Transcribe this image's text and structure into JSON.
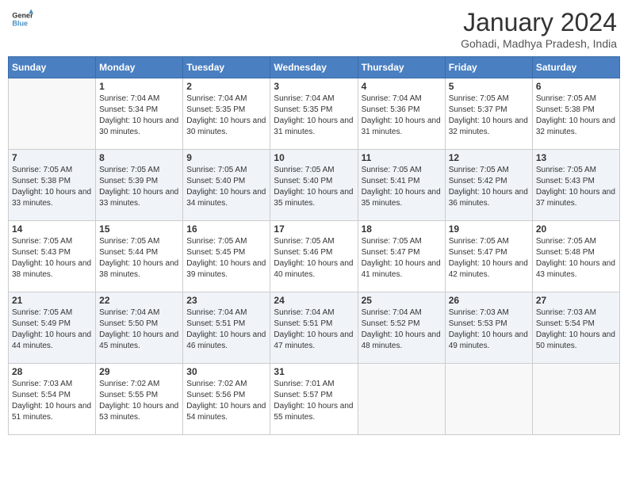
{
  "header": {
    "logo_general": "General",
    "logo_blue": "Blue",
    "month": "January 2024",
    "location": "Gohadi, Madhya Pradesh, India"
  },
  "days_of_week": [
    "Sunday",
    "Monday",
    "Tuesday",
    "Wednesday",
    "Thursday",
    "Friday",
    "Saturday"
  ],
  "weeks": [
    [
      {
        "day": "",
        "sunrise": "",
        "sunset": "",
        "daylight": ""
      },
      {
        "day": "1",
        "sunrise": "Sunrise: 7:04 AM",
        "sunset": "Sunset: 5:34 PM",
        "daylight": "Daylight: 10 hours and 30 minutes."
      },
      {
        "day": "2",
        "sunrise": "Sunrise: 7:04 AM",
        "sunset": "Sunset: 5:35 PM",
        "daylight": "Daylight: 10 hours and 30 minutes."
      },
      {
        "day": "3",
        "sunrise": "Sunrise: 7:04 AM",
        "sunset": "Sunset: 5:35 PM",
        "daylight": "Daylight: 10 hours and 31 minutes."
      },
      {
        "day": "4",
        "sunrise": "Sunrise: 7:04 AM",
        "sunset": "Sunset: 5:36 PM",
        "daylight": "Daylight: 10 hours and 31 minutes."
      },
      {
        "day": "5",
        "sunrise": "Sunrise: 7:05 AM",
        "sunset": "Sunset: 5:37 PM",
        "daylight": "Daylight: 10 hours and 32 minutes."
      },
      {
        "day": "6",
        "sunrise": "Sunrise: 7:05 AM",
        "sunset": "Sunset: 5:38 PM",
        "daylight": "Daylight: 10 hours and 32 minutes."
      }
    ],
    [
      {
        "day": "7",
        "sunrise": "Sunrise: 7:05 AM",
        "sunset": "Sunset: 5:38 PM",
        "daylight": "Daylight: 10 hours and 33 minutes."
      },
      {
        "day": "8",
        "sunrise": "Sunrise: 7:05 AM",
        "sunset": "Sunset: 5:39 PM",
        "daylight": "Daylight: 10 hours and 33 minutes."
      },
      {
        "day": "9",
        "sunrise": "Sunrise: 7:05 AM",
        "sunset": "Sunset: 5:40 PM",
        "daylight": "Daylight: 10 hours and 34 minutes."
      },
      {
        "day": "10",
        "sunrise": "Sunrise: 7:05 AM",
        "sunset": "Sunset: 5:40 PM",
        "daylight": "Daylight: 10 hours and 35 minutes."
      },
      {
        "day": "11",
        "sunrise": "Sunrise: 7:05 AM",
        "sunset": "Sunset: 5:41 PM",
        "daylight": "Daylight: 10 hours and 35 minutes."
      },
      {
        "day": "12",
        "sunrise": "Sunrise: 7:05 AM",
        "sunset": "Sunset: 5:42 PM",
        "daylight": "Daylight: 10 hours and 36 minutes."
      },
      {
        "day": "13",
        "sunrise": "Sunrise: 7:05 AM",
        "sunset": "Sunset: 5:43 PM",
        "daylight": "Daylight: 10 hours and 37 minutes."
      }
    ],
    [
      {
        "day": "14",
        "sunrise": "Sunrise: 7:05 AM",
        "sunset": "Sunset: 5:43 PM",
        "daylight": "Daylight: 10 hours and 38 minutes."
      },
      {
        "day": "15",
        "sunrise": "Sunrise: 7:05 AM",
        "sunset": "Sunset: 5:44 PM",
        "daylight": "Daylight: 10 hours and 38 minutes."
      },
      {
        "day": "16",
        "sunrise": "Sunrise: 7:05 AM",
        "sunset": "Sunset: 5:45 PM",
        "daylight": "Daylight: 10 hours and 39 minutes."
      },
      {
        "day": "17",
        "sunrise": "Sunrise: 7:05 AM",
        "sunset": "Sunset: 5:46 PM",
        "daylight": "Daylight: 10 hours and 40 minutes."
      },
      {
        "day": "18",
        "sunrise": "Sunrise: 7:05 AM",
        "sunset": "Sunset: 5:47 PM",
        "daylight": "Daylight: 10 hours and 41 minutes."
      },
      {
        "day": "19",
        "sunrise": "Sunrise: 7:05 AM",
        "sunset": "Sunset: 5:47 PM",
        "daylight": "Daylight: 10 hours and 42 minutes."
      },
      {
        "day": "20",
        "sunrise": "Sunrise: 7:05 AM",
        "sunset": "Sunset: 5:48 PM",
        "daylight": "Daylight: 10 hours and 43 minutes."
      }
    ],
    [
      {
        "day": "21",
        "sunrise": "Sunrise: 7:05 AM",
        "sunset": "Sunset: 5:49 PM",
        "daylight": "Daylight: 10 hours and 44 minutes."
      },
      {
        "day": "22",
        "sunrise": "Sunrise: 7:04 AM",
        "sunset": "Sunset: 5:50 PM",
        "daylight": "Daylight: 10 hours and 45 minutes."
      },
      {
        "day": "23",
        "sunrise": "Sunrise: 7:04 AM",
        "sunset": "Sunset: 5:51 PM",
        "daylight": "Daylight: 10 hours and 46 minutes."
      },
      {
        "day": "24",
        "sunrise": "Sunrise: 7:04 AM",
        "sunset": "Sunset: 5:51 PM",
        "daylight": "Daylight: 10 hours and 47 minutes."
      },
      {
        "day": "25",
        "sunrise": "Sunrise: 7:04 AM",
        "sunset": "Sunset: 5:52 PM",
        "daylight": "Daylight: 10 hours and 48 minutes."
      },
      {
        "day": "26",
        "sunrise": "Sunrise: 7:03 AM",
        "sunset": "Sunset: 5:53 PM",
        "daylight": "Daylight: 10 hours and 49 minutes."
      },
      {
        "day": "27",
        "sunrise": "Sunrise: 7:03 AM",
        "sunset": "Sunset: 5:54 PM",
        "daylight": "Daylight: 10 hours and 50 minutes."
      }
    ],
    [
      {
        "day": "28",
        "sunrise": "Sunrise: 7:03 AM",
        "sunset": "Sunset: 5:54 PM",
        "daylight": "Daylight: 10 hours and 51 minutes."
      },
      {
        "day": "29",
        "sunrise": "Sunrise: 7:02 AM",
        "sunset": "Sunset: 5:55 PM",
        "daylight": "Daylight: 10 hours and 53 minutes."
      },
      {
        "day": "30",
        "sunrise": "Sunrise: 7:02 AM",
        "sunset": "Sunset: 5:56 PM",
        "daylight": "Daylight: 10 hours and 54 minutes."
      },
      {
        "day": "31",
        "sunrise": "Sunrise: 7:01 AM",
        "sunset": "Sunset: 5:57 PM",
        "daylight": "Daylight: 10 hours and 55 minutes."
      },
      {
        "day": "",
        "sunrise": "",
        "sunset": "",
        "daylight": ""
      },
      {
        "day": "",
        "sunrise": "",
        "sunset": "",
        "daylight": ""
      },
      {
        "day": "",
        "sunrise": "",
        "sunset": "",
        "daylight": ""
      }
    ]
  ]
}
